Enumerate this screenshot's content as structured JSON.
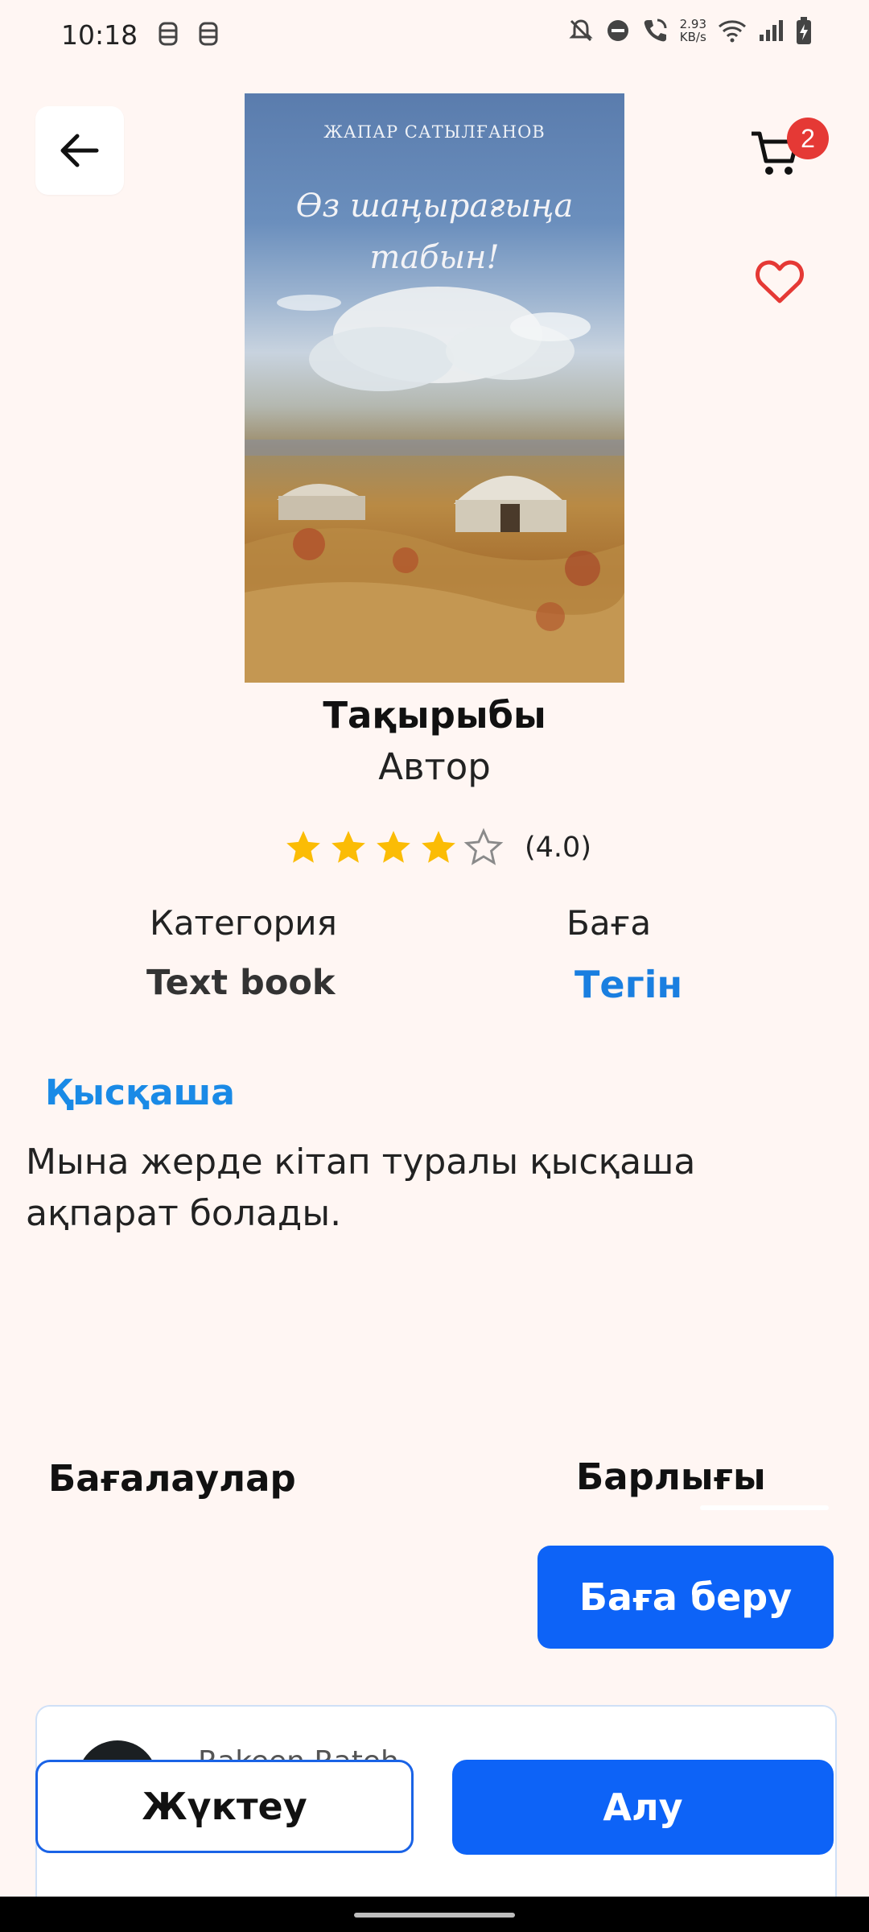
{
  "status_bar": {
    "time": "10:18",
    "left_icons": [
      "notification-icon",
      "notification-icon"
    ],
    "speed_value": "2.93",
    "speed_unit": "KB/s",
    "right_icons": [
      "mute-icon",
      "dnd-icon",
      "wifi-call-icon",
      "wifi-icon",
      "signal-icon",
      "battery-charging-icon"
    ]
  },
  "header": {
    "back_icon": "arrow-left-icon",
    "cart_icon": "cart-icon",
    "cart_count": "2",
    "favorite_icon": "heart-outline-icon"
  },
  "cover": {
    "author": "ЖАПАР САТЫЛҒАНОВ",
    "title_line1": "Өз шаңырағыңа",
    "title_line2": "табын!"
  },
  "book": {
    "title": "Тақырыбы",
    "author": "Автор",
    "rating": 4.0,
    "rating_text": "(4.0)",
    "max_rating": 5,
    "category_label": "Категория",
    "category_value": "Text book",
    "price_label": "Баға",
    "price_value": "Тегін",
    "summary_label": "Қысқаша",
    "summary_text": "Мына жерде кітап туралы қысқаша ақпарат болады."
  },
  "reviews": {
    "label": "Бағалаулар",
    "all_label": "Барлығы",
    "rate_button": "Баға беру",
    "first_reviewer": "Rakeen Rateh"
  },
  "actions": {
    "download": "Жүктеу",
    "buy": "Алу"
  },
  "colors": {
    "background": "#fff6f3",
    "primary": "#0d63f7",
    "accent_blue": "#1a8ae6",
    "star": "#fbbc05",
    "badge": "#e53935",
    "heart": "#e53935"
  }
}
